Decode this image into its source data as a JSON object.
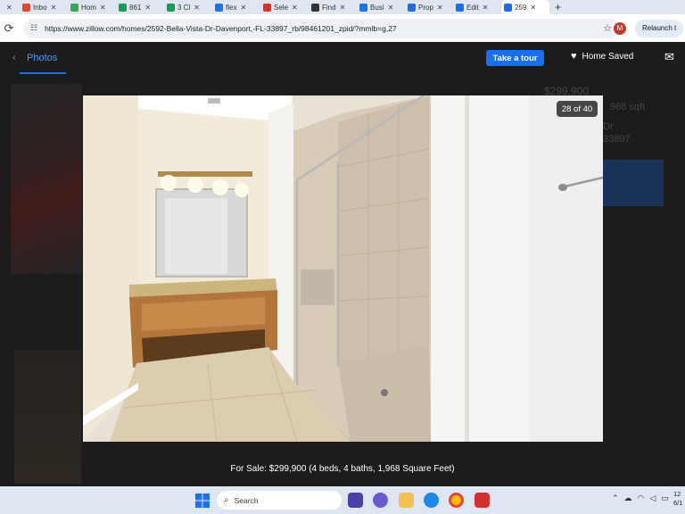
{
  "tabs": [
    {
      "label": "",
      "color": "#777777",
      "icon": "generic-icon"
    },
    {
      "label": "Inbo",
      "color": "#ea4335",
      "icon": "gmail-icon"
    },
    {
      "label": "Hom",
      "color": "#34a853",
      "icon": "drive-icon"
    },
    {
      "label": "861",
      "color": "#0f9d58",
      "icon": "sheets-icon"
    },
    {
      "label": "3 Cl",
      "color": "#0f9d58",
      "icon": "sheets-icon"
    },
    {
      "label": "flex",
      "color": "#1a73e8",
      "icon": "app-icon"
    },
    {
      "label": "Sele",
      "color": "#d93025",
      "icon": "app-icon"
    },
    {
      "label": "Find",
      "color": "#333333",
      "icon": "app-icon"
    },
    {
      "label": "Busi",
      "color": "#1a73e8",
      "icon": "app-icon"
    },
    {
      "label": "Prop",
      "color": "#1a6ff0",
      "icon": "zillow-icon"
    },
    {
      "label": "Edit",
      "color": "#1a6ff0",
      "icon": "zillow-icon"
    },
    {
      "label": "259",
      "color": "#1a6ff0",
      "icon": "zillow-icon"
    }
  ],
  "address": {
    "url": "https://www.zillow.com/homes/2592-Bella-Vista-Dr-Davenport,-FL-33897_rb/98461201_zpid/?mmlb=g,27",
    "profile_initial": "M",
    "relaunch_label": "Relaunch t"
  },
  "page": {
    "photos_tab": "Photos",
    "take_tour": "Take a tour",
    "home_saved": "Home Saved",
    "counter": "28 of 40",
    "caption": "For Sale: $299,900 (4 beds, 4 baths, 1,968 Square Feet)",
    "bg_price": "$299,900",
    "bg_sqft": "968 sqft",
    "bg_street": "Dr",
    "bg_zip": "33897"
  },
  "taskbar": {
    "search_placeholder": "Search",
    "clock_time": "12",
    "clock_date": "6/1"
  },
  "colors": {
    "accent": "#1a6ff0",
    "background": "#1c1c1c"
  }
}
